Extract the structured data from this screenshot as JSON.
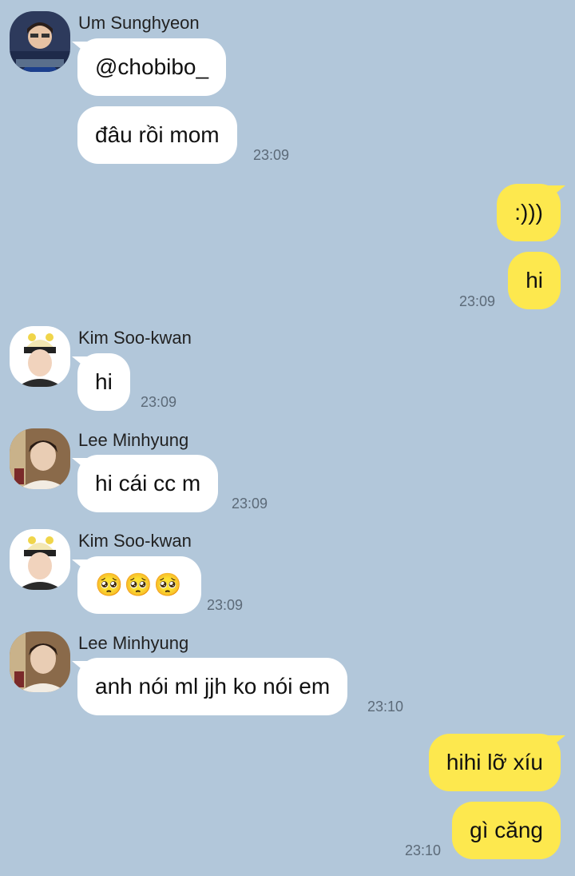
{
  "colors": {
    "background": "#b2c7da",
    "incoming_bubble": "#ffffff",
    "outgoing_bubble": "#fde84e",
    "timestamp": "#5c6a78"
  },
  "messages": [
    {
      "sender": "Um Sunghyeon",
      "text": "@chobibo_"
    },
    {
      "text": "đâu rồi mom",
      "time": "23:09"
    },
    {
      "outgoing": true,
      "text": ":)))"
    },
    {
      "outgoing": true,
      "text": "hi",
      "time": "23:09"
    },
    {
      "sender": "Kim Soo-kwan",
      "text": "hi",
      "time": "23:09"
    },
    {
      "sender": "Lee Minhyung",
      "text": "hi cái cc m",
      "time": "23:09"
    },
    {
      "sender": "Kim Soo-kwan",
      "text": "🥺🥺🥺",
      "time": "23:09"
    },
    {
      "sender": "Lee Minhyung",
      "text": "anh nói ml jjh ko nói em",
      "time": "23:10"
    },
    {
      "outgoing": true,
      "text": "hihi lỡ xíu"
    },
    {
      "outgoing": true,
      "text": "gì căng",
      "time": "23:10"
    }
  ]
}
